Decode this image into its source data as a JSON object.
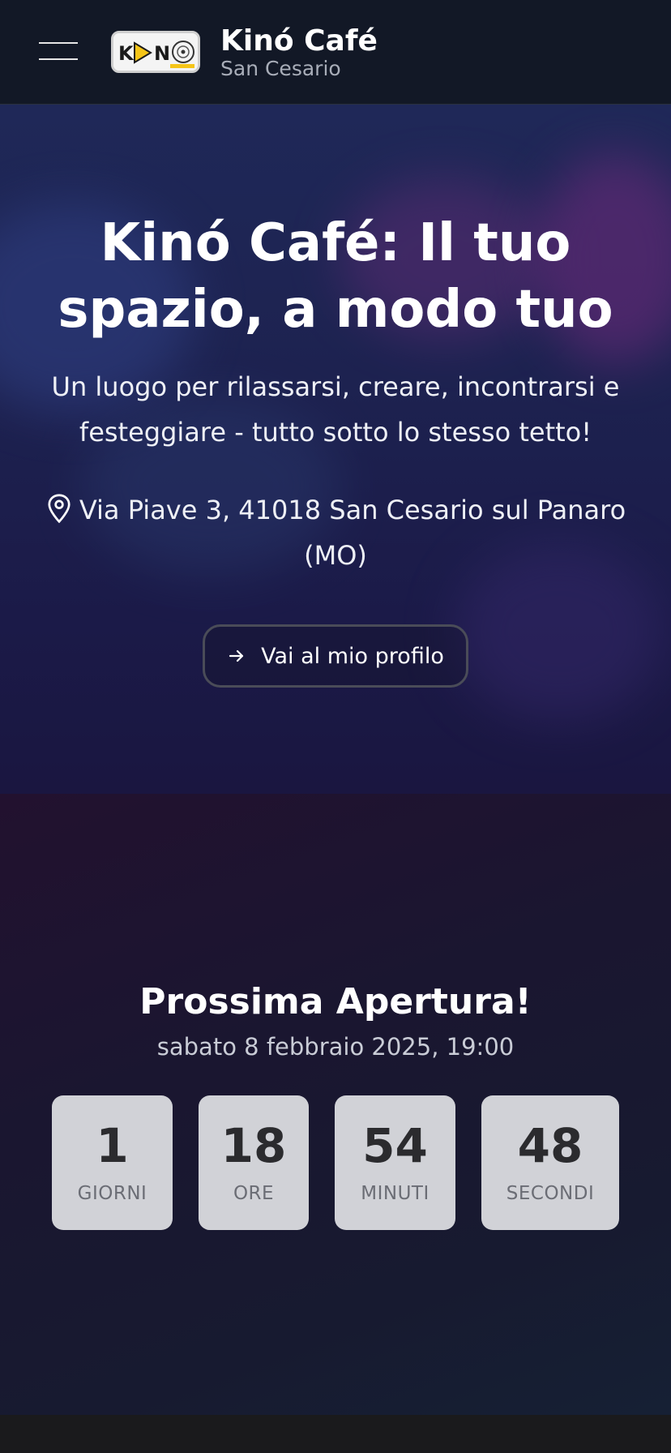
{
  "header": {
    "brand_title": "Kinó Café",
    "brand_subtitle": "San Cesario"
  },
  "hero": {
    "title_line1": "Kinó Café: Il tuo",
    "title_line2": "spazio, a modo tuo",
    "subtitle_line1": "Un luogo per rilassarsi, creare, incontrarsi e",
    "subtitle_line2": "festeggiare - tutto sotto lo stesso tetto!",
    "address_line1": "Via Piave 3, 41018 San Cesario sul Panaro",
    "address_line2": "(MO)",
    "profile_button_label": "Vai al mio profilo"
  },
  "countdown": {
    "title": "Prossima Apertura!",
    "date": "sabato 8 febbraio 2025, 19:00",
    "units": [
      {
        "value": "1",
        "label": "GIORNI"
      },
      {
        "value": "18",
        "label": "ORE"
      },
      {
        "value": "54",
        "label": "MINUTI"
      },
      {
        "value": "48",
        "label": "SECONDI"
      }
    ]
  },
  "icons": {
    "menu": "hamburger-menu-icon",
    "location": "map-pin-icon",
    "arrow": "arrow-right-icon"
  },
  "colors": {
    "header_bg": "#121826",
    "accent_yellow": "#f5c518",
    "countdown_box": "#d1d2d7"
  }
}
